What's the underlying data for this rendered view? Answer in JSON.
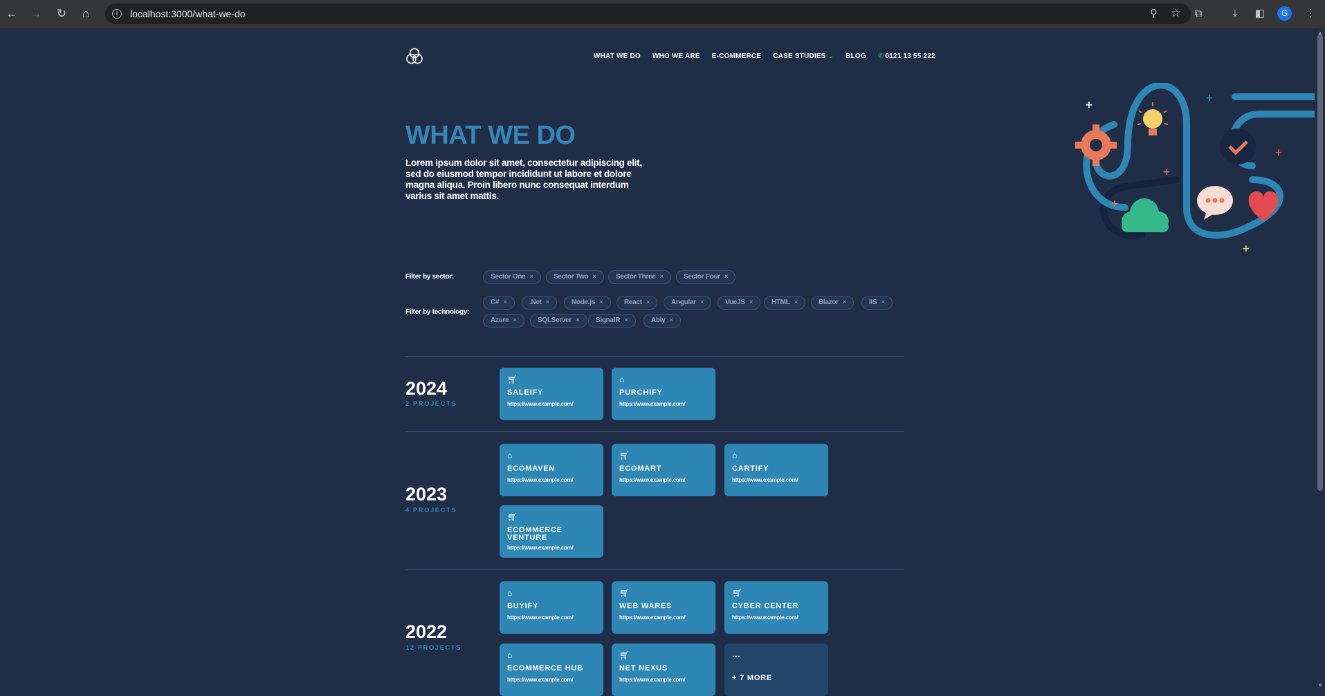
{
  "browser": {
    "url": "localhost:3000/what-we-do",
    "profile_initial": "G"
  },
  "nav": {
    "items": [
      "WHAT WE DO",
      "WHO WE ARE",
      "E-COMMERCE",
      "CASE STUDIES",
      "BLOG"
    ],
    "case_studies_chevron": "⌄",
    "phone": "0121 13 55 222"
  },
  "hero": {
    "title": "WHAT WE DO",
    "text": "Lorem ipsum dolor sit amet, consectetur adipiscing elit, sed do eiusmod tempor incididunt ut labore et dolore magna aliqua. Proin libero nunc consequat interdum varius sit amet mattis."
  },
  "filters": {
    "sector_label": "Filter by sector:",
    "sectors": [
      "Sector One",
      "Sector Two",
      "Sector Three",
      "Sector Four"
    ],
    "technology_label": "Filter by technology:",
    "technologies": [
      "C#",
      ".Net",
      "Node.js",
      "React",
      "Angular",
      "VueJS",
      "HTML",
      "Blazor",
      "IIS",
      "Azure",
      "SQLServer",
      "SignalR",
      "Ably"
    ],
    "remove_glyph": "×"
  },
  "years": [
    {
      "year": "2024",
      "count": "2 PROJECTS",
      "projects": [
        {
          "name": "SALEIFY",
          "url": "https://www.example.com/",
          "icon": "cart-icon"
        },
        {
          "name": "PURCHIFY",
          "url": "https://www.example.com/",
          "icon": "basket-icon"
        }
      ]
    },
    {
      "year": "2023",
      "count": "4 PROJECTS",
      "projects": [
        {
          "name": "ECOMAVEN",
          "url": "https://www.example.com/",
          "icon": "basket-icon"
        },
        {
          "name": "ECOMART",
          "url": "https://www.example.com/",
          "icon": "cart-icon"
        },
        {
          "name": "CARTIFY",
          "url": "https://www.example.com/",
          "icon": "basket-icon"
        },
        {
          "name": "ECOMMERCE VENTURE",
          "url": "https://www.example.com/",
          "icon": "cart-icon"
        }
      ]
    },
    {
      "year": "2022",
      "count": "12 PROJECTS",
      "projects": [
        {
          "name": "BUYIFY",
          "url": "https://www.example.com/",
          "icon": "basket-icon"
        },
        {
          "name": "WEB WARES",
          "url": "https://www.example.com/",
          "icon": "cart-icon"
        },
        {
          "name": "CYBER CENTER",
          "url": "https://www.example.com/",
          "icon": "cart-icon"
        },
        {
          "name": "ECOMMERCE HUB",
          "url": "https://www.example.com/",
          "icon": "basket-icon"
        },
        {
          "name": "NET NEXUS",
          "url": "https://www.example.com/",
          "icon": "cart-icon"
        }
      ],
      "more": {
        "dots": "...",
        "label": "+ 7 MORE"
      }
    }
  ],
  "colors": {
    "background": "#1f2d47",
    "accent": "#3586b8",
    "card": "#2e86b4",
    "more_card": "#23456a"
  }
}
